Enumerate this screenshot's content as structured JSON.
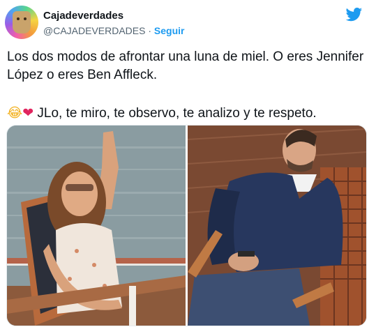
{
  "author": {
    "display_name": "Cajadeverdades",
    "handle": "@CAJADEVERDADES",
    "separator": "·",
    "follow_label": "Seguir"
  },
  "tweet": {
    "line1": "Los dos modos de afrontar una luna de miel. O eres Jennifer López o eres Ben Affleck.",
    "emoji1": "😂",
    "emoji2": "❤",
    "line2": " JLo, te miro, te observo, te analizo y te respeto."
  },
  "icons": {
    "brand": "twitter-bird-icon",
    "avatar": "cardboard-box-character"
  },
  "colors": {
    "brand": "#1d9bf0",
    "text": "#0f1419",
    "secondary": "#536471"
  }
}
